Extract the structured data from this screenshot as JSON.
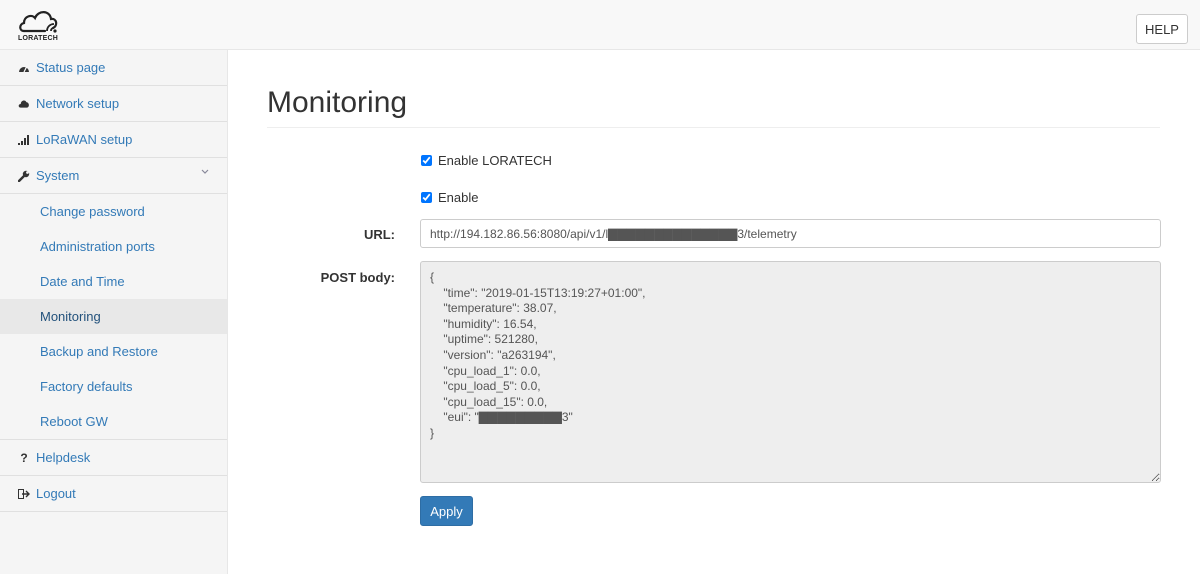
{
  "header": {
    "logo_text": "LORATECH",
    "help_label": "HELP"
  },
  "sidebar": {
    "items": [
      {
        "label": "Status page",
        "icon": "dashboard-icon"
      },
      {
        "label": "Network setup",
        "icon": "cloud-icon"
      },
      {
        "label": "LoRaWAN setup",
        "icon": "signal-icon"
      },
      {
        "label": "System",
        "icon": "wrench-icon"
      },
      {
        "label": "Helpdesk",
        "icon": "question-icon"
      },
      {
        "label": "Logout",
        "icon": "logout-icon"
      }
    ],
    "system_sub": [
      {
        "label": "Change password"
      },
      {
        "label": "Administration ports"
      },
      {
        "label": "Date and Time"
      },
      {
        "label": "Monitoring",
        "active": true
      },
      {
        "label": "Backup and Restore"
      },
      {
        "label": "Factory defaults"
      },
      {
        "label": "Reboot GW"
      }
    ]
  },
  "main": {
    "title": "Monitoring",
    "enable_loratech_label": "Enable LORATECH",
    "enable_loratech_checked": true,
    "enable_label": "Enable",
    "enable_checked": true,
    "url_label": "URL:",
    "url_value": "http://194.182.86.56:8080/api/v1/l▇▇▇▇▇▇▇▇▇▇▇▇▇▇3/telemetry",
    "post_body_label": "POST body:",
    "post_body_value": "{\n    \"time\": \"2019-01-15T13:19:27+01:00\",\n    \"temperature\": 38.07,\n    \"humidity\": 16.54,\n    \"uptime\": 521280,\n    \"version\": \"a263194\",\n    \"cpu_load_1\": 0.0,\n    \"cpu_load_5\": 0.0,\n    \"cpu_load_15\": 0.0,\n    \"eui\": \"▇▇▇▇▇▇▇▇▇3\"\n}",
    "apply_label": "Apply"
  },
  "colors": {
    "link": "#337ab7",
    "primary_button": "#337ab7",
    "sidebar_bg": "#f5f5f5",
    "active_bg": "#e8e8e8"
  }
}
